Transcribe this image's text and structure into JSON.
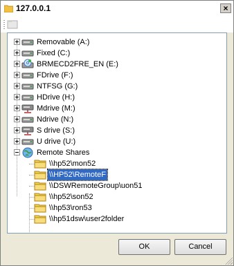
{
  "window": {
    "title": "127.0.0.1",
    "close_label": "×"
  },
  "tree": {
    "drives": [
      {
        "label": "Removable (A:)",
        "icon": "drive-icon"
      },
      {
        "label": "Fixed (C:)",
        "icon": "drive-icon"
      },
      {
        "label": "BRMECD2FRE_EN (E:)",
        "icon": "cd-drive-icon"
      },
      {
        "label": "FDrive (F:)",
        "icon": "drive-icon"
      },
      {
        "label": "NTFSG (G:)",
        "icon": "drive-icon"
      },
      {
        "label": "HDrive (H:)",
        "icon": "drive-icon"
      },
      {
        "label": "Mdrive (M:)",
        "icon": "network-drive-icon"
      },
      {
        "label": "Ndrive (N:)",
        "icon": "drive-icon"
      },
      {
        "label": "S drive (S:)",
        "icon": "network-drive-icon"
      },
      {
        "label": "U drive (U:)",
        "icon": "drive-icon"
      }
    ],
    "remote": {
      "label": "Remote Shares",
      "icon": "globe-icon",
      "shares": [
        {
          "label": "\\\\hp52\\mon52",
          "selected": false
        },
        {
          "label": "\\\\HP52\\RemoteF",
          "selected": true
        },
        {
          "label": "\\\\DSWRemoteGroup\\uon51",
          "selected": false
        },
        {
          "label": "\\\\hp52\\son52",
          "selected": false
        },
        {
          "label": "\\\\hp53\\ron53",
          "selected": false
        },
        {
          "label": "\\\\hp51dsw\\user2folder",
          "selected": false
        }
      ]
    }
  },
  "buttons": {
    "ok": "OK",
    "cancel": "Cancel"
  },
  "colors": {
    "selection": "#316ac5",
    "folder": "#f3d35a",
    "drive": "#707070",
    "network_drive": "#c0504d"
  }
}
